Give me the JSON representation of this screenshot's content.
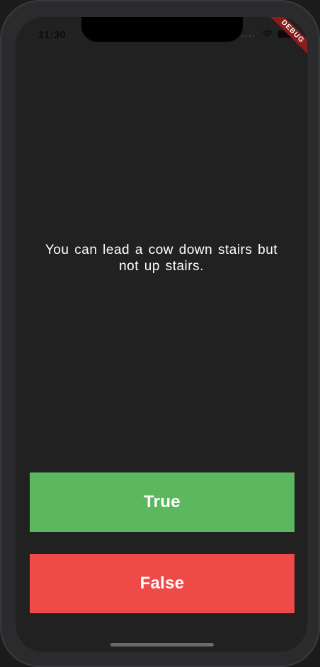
{
  "status_bar": {
    "time": "11:30",
    "icons": [
      "cellular-signal-icon",
      "wifi-icon",
      "battery-icon"
    ]
  },
  "debug_banner": {
    "label": "DEBUG"
  },
  "quiz": {
    "question": "You can lead a cow down stairs but not up stairs."
  },
  "buttons": {
    "true_label": "True",
    "false_label": "False"
  },
  "colors": {
    "background": "#212121",
    "true_button": "#5cb85f",
    "false_button": "#ee4a48",
    "debug_banner": "#8a1c1c",
    "text": "#ffffff"
  }
}
